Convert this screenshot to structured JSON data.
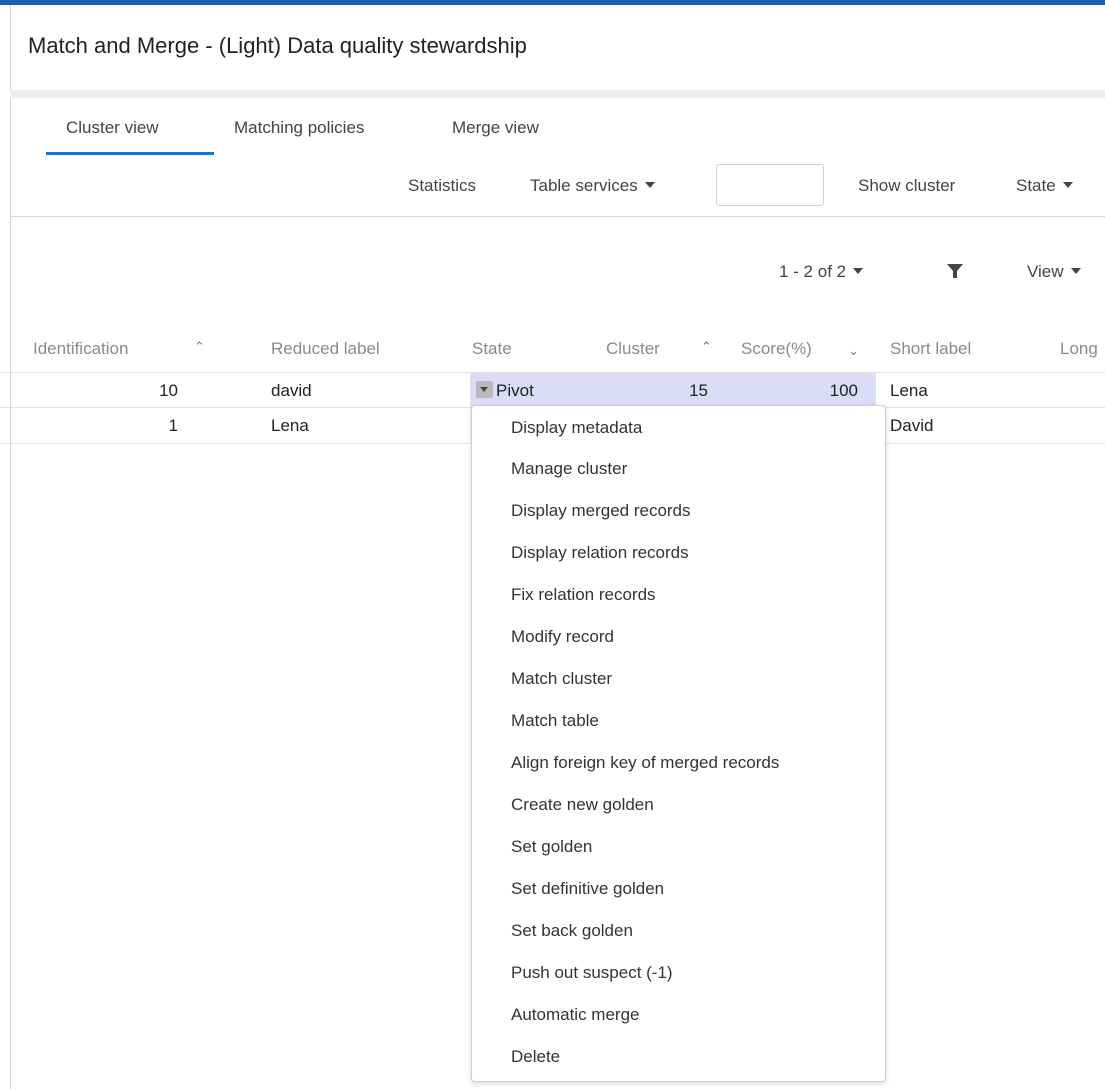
{
  "title": "Match and Merge - (Light) Data quality stewardship",
  "tabs": [
    "Cluster view",
    "Matching policies",
    "Merge view"
  ],
  "toolbar": {
    "statistics": "Statistics",
    "table_services": "Table services",
    "search_value": "",
    "show_cluster": "Show cluster",
    "state": "State"
  },
  "pager": {
    "label": "1 - 2 of 2",
    "view": "View"
  },
  "columns": {
    "identification": "Identification",
    "reduced_label": "Reduced label",
    "state": "State",
    "cluster": "Cluster",
    "score": "Score(%)",
    "short_label": "Short label",
    "long_label": "Long"
  },
  "rows": [
    {
      "identification": "10",
      "reduced_label": "david",
      "state": "Pivot",
      "cluster": "15",
      "score": "100",
      "short_label": "Lena"
    },
    {
      "identification": "1",
      "reduced_label": "Lena",
      "state": "",
      "cluster": "",
      "score": "",
      "short_label": "David"
    }
  ],
  "menu_items": [
    "Display metadata",
    "Manage cluster",
    "Display merged records",
    "Display relation records",
    "Fix relation records",
    "Modify record",
    "Match cluster",
    "Match table",
    "Align foreign key of merged records",
    "Create new golden",
    "Set golden",
    "Set definitive golden",
    "Set back golden",
    "Push out suspect (-1)",
    "Automatic merge",
    "Delete"
  ],
  "colors": {
    "accent": "#1f6fc4",
    "top_bar": "#1f5fa8",
    "row_highlight": "#dcdcf7"
  }
}
